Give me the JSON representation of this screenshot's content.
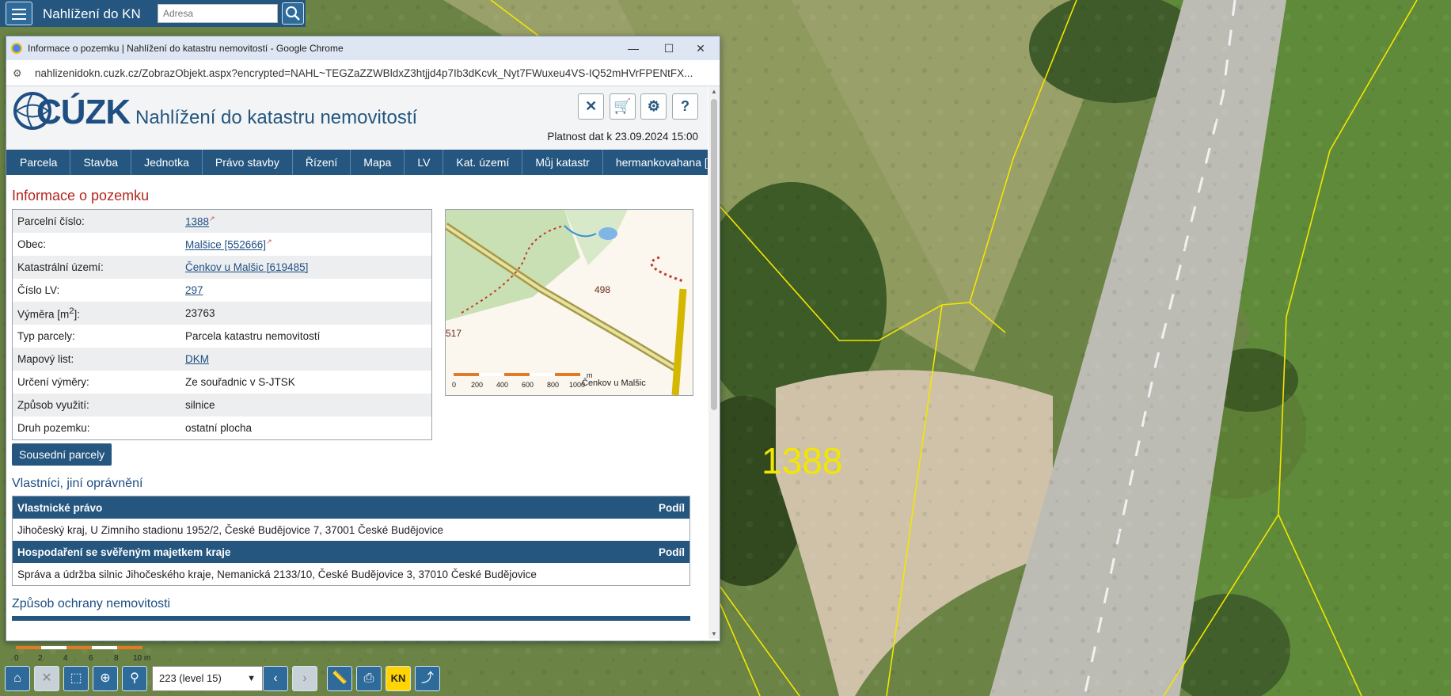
{
  "app": {
    "title": "Nahlížení do KN",
    "search_placeholder": "Adresa"
  },
  "map": {
    "parcel_label": "1388",
    "scale_ticks": [
      "0",
      "2",
      "4",
      "6",
      "8",
      "10 m"
    ]
  },
  "toolbar": {
    "level_select": "223 (level 15)",
    "kn_label": "KN",
    "icons": [
      "home-icon",
      "close-icon",
      "select-area-icon",
      "locate-icon",
      "marker-icon",
      "prev-icon",
      "next-icon",
      "measure-icon",
      "print-icon",
      "kn-layer-icon",
      "share-icon"
    ]
  },
  "popup": {
    "window_title": "Informace o pozemku | Nahlížení do katastru nemovitostí - Google Chrome",
    "url": "nahlizenidokn.cuzk.cz/ZobrazObjekt.aspx?encrypted=NAHL~TEGZaZZWBldxZ3htjjd4p7Ib3dKcvk_Nyt7FWuxeu4VS-IQ52mHVrFPENtFX...",
    "logo_text": "CÚZK",
    "site_title": "Nahlížení do katastru nemovitostí",
    "validity": "Platnost dat k 23.09.2024 15:00",
    "nav": [
      "Parcela",
      "Stavba",
      "Jednotka",
      "Právo stavby",
      "Řízení",
      "Mapa",
      "LV",
      "Kat. území",
      "Můj katastr",
      "hermankovahana [DP]"
    ],
    "heading": "Informace o pozemku",
    "parcel_info": [
      {
        "key": "Parcelní číslo:",
        "value": "1388",
        "link": true,
        "ext": true
      },
      {
        "key": "Obec:",
        "value": "Malšice [552666]",
        "link": true,
        "ext": true
      },
      {
        "key": "Katastrální území:",
        "value": "Čenkov u Malšic [619485]",
        "link": true,
        "ext": false
      },
      {
        "key": "Číslo LV:",
        "value": "297",
        "link": true,
        "ext": false
      },
      {
        "key": "Výměra [m",
        "key_sup": "2",
        "key_tail": "]:",
        "value": "23763",
        "link": false,
        "ext": false
      },
      {
        "key": "Typ parcely:",
        "value": "Parcela katastru nemovitostí",
        "link": false,
        "ext": false
      },
      {
        "key": "Mapový list:",
        "value": "DKM",
        "link": true,
        "ext": false
      },
      {
        "key": "Určení výměry:",
        "value": "Ze souřadnic v S-JTSK",
        "link": false,
        "ext": false
      },
      {
        "key": "Způsob využití:",
        "value": "silnice",
        "link": false,
        "ext": false
      },
      {
        "key": "Druh pozemku:",
        "value": "ostatní plocha",
        "link": false,
        "ext": false
      }
    ],
    "minimap": {
      "labels": [
        "498",
        "517",
        "Čenkov u Malšic"
      ],
      "scale": [
        "0",
        "200",
        "400",
        "600",
        "800",
        "1000",
        "m"
      ]
    },
    "neighbors_button": "Sousední parcely",
    "owners_heading": "Vlastníci, jiní oprávnění",
    "owners": [
      {
        "header": "Vlastnické právo",
        "share_header": "Podíl",
        "row": "Jihočeský kraj, U Zimního stadionu 1952/2, České Budějovice 7, 37001 České Budějovice"
      },
      {
        "header": "Hospodaření se svěřeným majetkem kraje",
        "share_header": "Podíl",
        "row": "Správa a údržba silnic Jihočeského kraje, Nemanická 2133/10, České Budějovice 3, 37010 České Budějovice"
      }
    ],
    "protection_heading": "Způsob ochrany nemovitosti"
  }
}
